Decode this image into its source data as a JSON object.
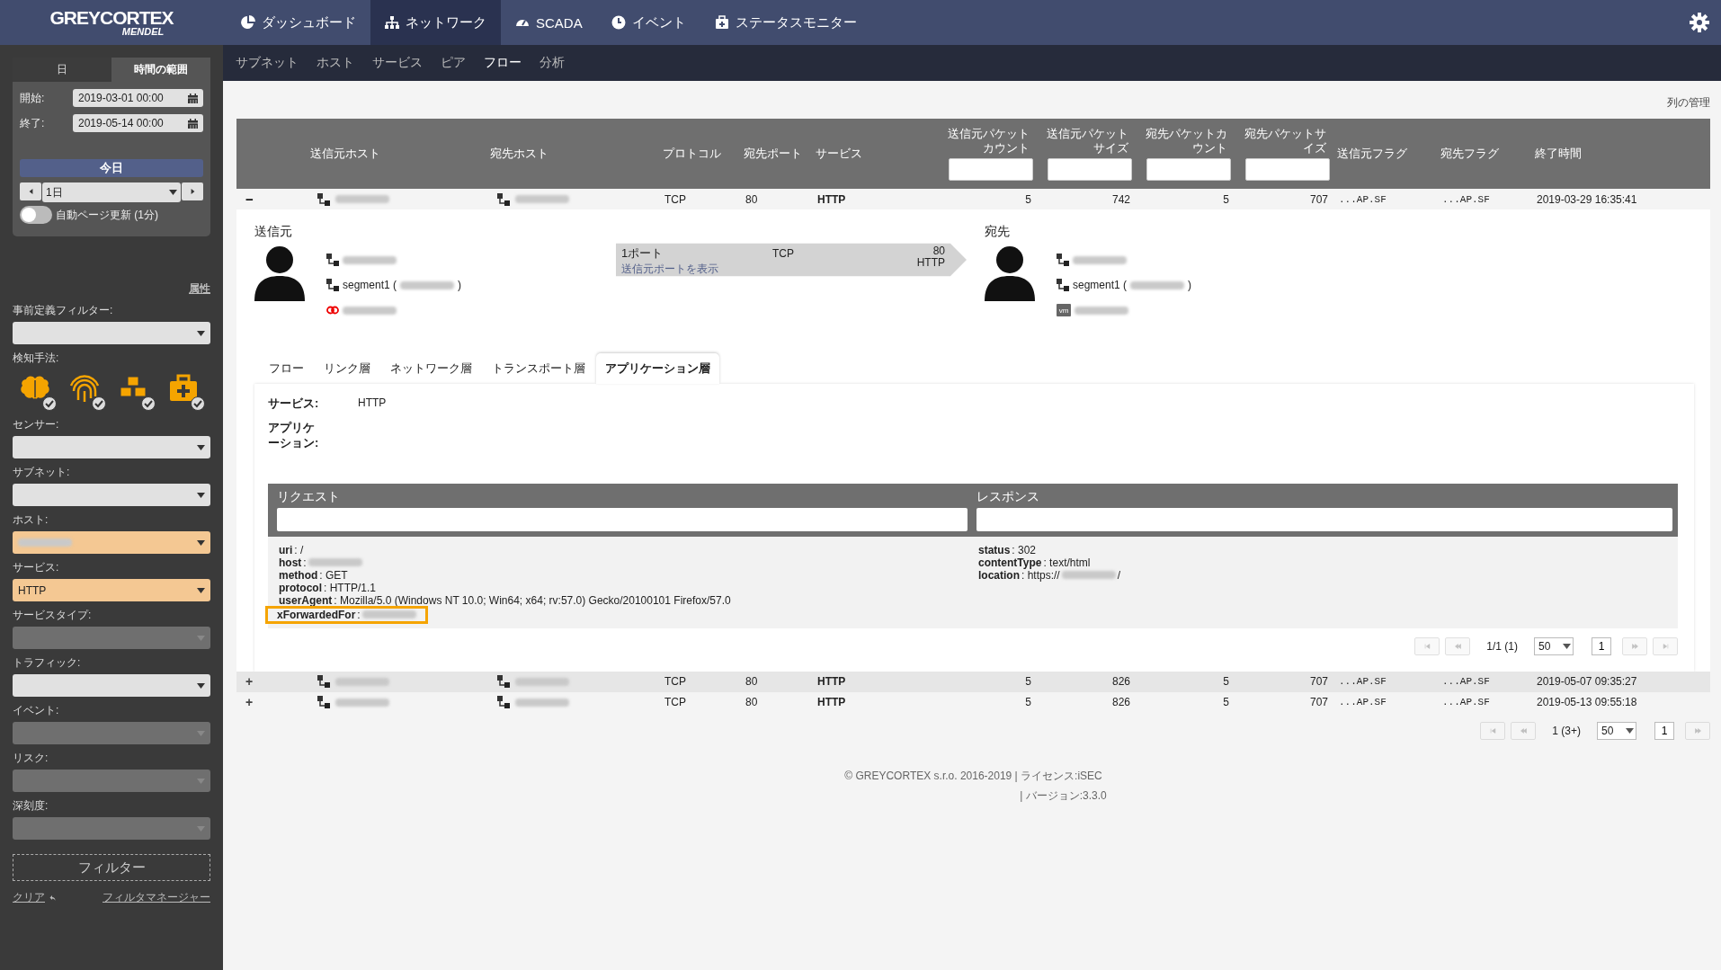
{
  "logo": {
    "brand": "GREYCORTEX",
    "product": "MENDEL"
  },
  "nav": [
    {
      "label": "ダッシュボード",
      "kind": "pie",
      "selected": false
    },
    {
      "label": "ネットワーク",
      "kind": "sitemap",
      "selected": true
    },
    {
      "label": "SCADA",
      "kind": "gauge",
      "selected": false
    },
    {
      "label": "イベント",
      "kind": "clock",
      "selected": false
    },
    {
      "label": "ステータスモニター",
      "kind": "medkit",
      "selected": false
    }
  ],
  "subnav": [
    {
      "label": "サブネット",
      "selected": false
    },
    {
      "label": "ホスト",
      "selected": false
    },
    {
      "label": "サービス",
      "selected": false
    },
    {
      "label": "ピア",
      "selected": false
    },
    {
      "label": "フロー",
      "selected": true
    },
    {
      "label": "分析",
      "selected": false
    }
  ],
  "sidebar": {
    "time_tabs": [
      {
        "label": "日",
        "selected": false
      },
      {
        "label": "時間の範囲",
        "selected": true
      }
    ],
    "start": {
      "label": "開始:",
      "value": "2019-03-01 00:00"
    },
    "end": {
      "label": "終了:",
      "value": "2019-05-14 00:00"
    },
    "today_button": "今日",
    "period": {
      "value": "1日"
    },
    "auto_refresh": {
      "label": "自動ページ更新 (1分)",
      "on": false
    },
    "attributes_link": "属性",
    "predefined_filter": {
      "label": "事前定義フィルター:"
    },
    "detection": {
      "label": "検知手法:",
      "methods": [
        {
          "kind": "brain",
          "checked": true
        },
        {
          "kind": "fingerprint",
          "checked": true
        },
        {
          "kind": "cubes",
          "checked": true
        },
        {
          "kind": "medkit",
          "checked": true
        }
      ]
    },
    "filters": [
      {
        "label": "センサー:",
        "disabled": false,
        "highlighted": false
      },
      {
        "label": "サブネット:",
        "disabled": false,
        "highlighted": false
      },
      {
        "label": "ホスト:",
        "disabled": false,
        "highlighted": true,
        "redacted": true
      },
      {
        "label": "サービス:",
        "disabled": false,
        "highlighted": true,
        "value": "HTTP"
      },
      {
        "label": "サービスタイプ:",
        "disabled": true,
        "highlighted": false
      },
      {
        "label": "トラフィック:",
        "disabled": false,
        "highlighted": false
      },
      {
        "label": "イベント:",
        "disabled": true,
        "highlighted": false
      },
      {
        "label": "リスク:",
        "disabled": true,
        "highlighted": false
      },
      {
        "label": "深刻度:",
        "disabled": true,
        "highlighted": false
      }
    ],
    "filter_button": "フィルター",
    "clear_link": "クリア",
    "filter_manager_link": "フィルタマネージャー"
  },
  "manage_columns_link": "列の管理",
  "table": {
    "columns": [
      {
        "label": "送信元ホスト",
        "filter": false
      },
      {
        "label": "宛先ホスト",
        "filter": false
      },
      {
        "label": "プロトコル",
        "filter": false
      },
      {
        "label": "宛先ポート",
        "filter": false
      },
      {
        "label": "サービス",
        "filter": false
      },
      {
        "label": "送信元パケットカウント",
        "filter": true
      },
      {
        "label": "送信元パケットサイズ",
        "filter": true
      },
      {
        "label": "宛先パケットカウント",
        "filter": true
      },
      {
        "label": "宛先パケットサイズ",
        "filter": true
      },
      {
        "label": "送信元フラグ",
        "filter": false
      },
      {
        "label": "宛先フラグ",
        "filter": false
      },
      {
        "label": "終了時間",
        "filter": false
      }
    ],
    "rows": [
      {
        "toggle": "−",
        "expanded": true,
        "protocol": "TCP",
        "port": "80",
        "service": "HTTP",
        "src_count": "5",
        "src_size": "742",
        "dst_count": "5",
        "dst_size": "707",
        "src_flags": "...AP.SF",
        "dst_flags": "...AP.SF",
        "end_time": "2019-03-29 16:35:41"
      },
      {
        "toggle": "+",
        "expanded": false,
        "protocol": "TCP",
        "port": "80",
        "service": "HTTP",
        "src_count": "5",
        "src_size": "826",
        "dst_count": "5",
        "dst_size": "707",
        "src_flags": "...AP.SF",
        "dst_flags": "...AP.SF",
        "end_time": "2019-05-07 09:35:27"
      },
      {
        "toggle": "+",
        "expanded": false,
        "protocol": "TCP",
        "port": "80",
        "service": "HTTP",
        "src_count": "5",
        "src_size": "826",
        "dst_count": "5",
        "dst_size": "707",
        "src_flags": "...AP.SF",
        "dst_flags": "...AP.SF",
        "end_time": "2019-05-13 09:55:18"
      }
    ]
  },
  "detail": {
    "source": {
      "title": "送信元",
      "lines": [
        {
          "kind": "network"
        },
        {
          "kind": "network",
          "prefix": "segment1 (",
          "suffix": ")"
        },
        {
          "kind": "link"
        }
      ]
    },
    "flow_arrow": {
      "ports": "1ポート",
      "show_ports_link": "送信元ポートを表示",
      "protocol": "TCP",
      "port": "80",
      "service": "HTTP"
    },
    "destination": {
      "title": "宛先",
      "lines": [
        {
          "kind": "network"
        },
        {
          "kind": "network",
          "prefix": "segment1 (",
          "suffix": ")"
        },
        {
          "kind": "vm",
          "badge": "vm"
        }
      ]
    },
    "tabs": [
      {
        "label": "フロー",
        "selected": false
      },
      {
        "label": "リンク層",
        "selected": false
      },
      {
        "label": "ネットワーク層",
        "selected": false
      },
      {
        "label": "トランスポート層",
        "selected": false
      },
      {
        "label": "アプリケーション層",
        "selected": true
      }
    ],
    "service": {
      "label": "サービス:",
      "value": "HTTP"
    },
    "application": {
      "label": "アプリケーション:"
    },
    "request": {
      "title": "リクエスト",
      "fields": [
        {
          "key": "uri",
          "value": ": /",
          "redacted": false,
          "highlighted": false
        },
        {
          "key": "host",
          "value": ":",
          "redacted": true,
          "highlighted": false
        },
        {
          "key": "method",
          "value": ": GET",
          "redacted": false,
          "highlighted": false
        },
        {
          "key": "protocol",
          "value": ": HTTP/1.1",
          "redacted": false,
          "highlighted": false
        },
        {
          "key": "userAgent",
          "value": ": Mozilla/5.0 (Windows NT 10.0; Win64; x64; rv:57.0) Gecko/20100101 Firefox/57.0",
          "redacted": false,
          "highlighted": false
        },
        {
          "key": "xForwardedFor",
          "value": ":",
          "redacted": true,
          "highlighted": true
        }
      ]
    },
    "response": {
      "title": "レスポンス",
      "fields": [
        {
          "key": "status",
          "value": ": 302",
          "redacted": false,
          "highlighted": false
        },
        {
          "key": "contentType",
          "value": ": text/html",
          "redacted": false,
          "highlighted": false
        },
        {
          "key": "location",
          "value": ": https://",
          "redacted": true,
          "suffix": "/",
          "highlighted": false
        }
      ]
    },
    "pagination": {
      "info": "1/1 (1)",
      "page_size": "50",
      "page": "1",
      "buttons": [
        {
          "kind": "first",
          "disabled": true
        },
        {
          "kind": "prev",
          "disabled": true
        },
        {
          "kind": "next",
          "disabled": true
        },
        {
          "kind": "last",
          "disabled": true
        }
      ]
    }
  },
  "pagination": {
    "info": "1 (3+)",
    "page_size": "50",
    "page": "1",
    "buttons": [
      {
        "kind": "first",
        "disabled": true
      },
      {
        "kind": "prev",
        "disabled": true
      },
      {
        "kind": "next",
        "disabled": true
      }
    ]
  },
  "footer": {
    "line1": "© GREYCORTEX s.r.o. 2016-2019 | ライセンス:iSEC",
    "line2": "| バージョン:3.3.0"
  }
}
